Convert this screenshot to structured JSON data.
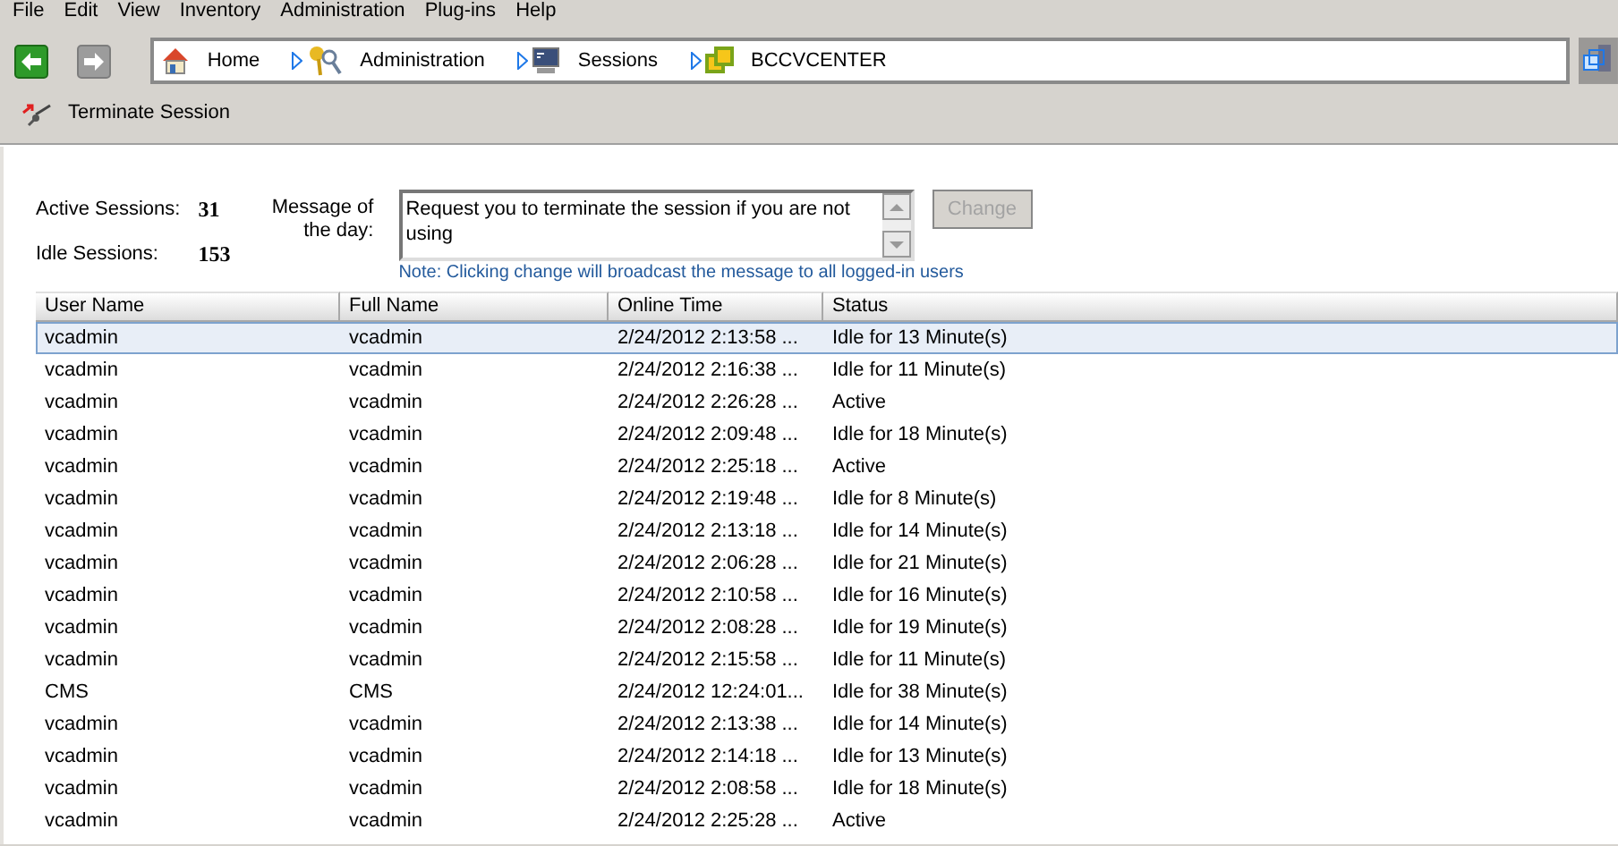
{
  "menu_bar": [
    "File",
    "Edit",
    "View",
    "Inventory",
    "Administration",
    "Plug-ins",
    "Help"
  ],
  "breadcrumb": [
    {
      "label": "Home",
      "kind": "home"
    },
    {
      "label": "Administration",
      "kind": "admin"
    },
    {
      "label": "Sessions",
      "kind": "sessions"
    },
    {
      "label": "BCCVCENTER",
      "kind": "vcenter"
    }
  ],
  "toolbar": {
    "terminate_button": "Terminate Session"
  },
  "summary": {
    "active_label": "Active Sessions:",
    "active_value": "31",
    "idle_label": "Idle Sessions:",
    "idle_value": "153"
  },
  "message": {
    "label_line_1": "Message of",
    "label_line_2": "the day:",
    "value": "Request you to terminate the session if you are not using",
    "change_button": "Change",
    "change_disabled": true,
    "note": "Note: Clicking change will broadcast the message to all logged-in users"
  },
  "table": {
    "columns": [
      "User Name",
      "Full Name",
      "Online Time",
      "Status"
    ],
    "rows": [
      {
        "cells": [
          "vcadmin",
          "vcadmin",
          "2/24/2012 2:13:58 ...",
          "Idle for 13 Minute(s)"
        ],
        "selected": true
      },
      {
        "cells": [
          "vcadmin",
          "vcadmin",
          "2/24/2012 2:16:38 ...",
          "Idle for 11 Minute(s)"
        ],
        "selected": false
      },
      {
        "cells": [
          "vcadmin",
          "vcadmin",
          "2/24/2012 2:26:28 ...",
          "Active"
        ],
        "selected": false
      },
      {
        "cells": [
          "vcadmin",
          "vcadmin",
          "2/24/2012 2:09:48 ...",
          "Idle for 18 Minute(s)"
        ],
        "selected": false
      },
      {
        "cells": [
          "vcadmin",
          "vcadmin",
          "2/24/2012 2:25:18 ...",
          "Active"
        ],
        "selected": false
      },
      {
        "cells": [
          "vcadmin",
          "vcadmin",
          "2/24/2012 2:19:48 ...",
          "Idle for 8 Minute(s)"
        ],
        "selected": false
      },
      {
        "cells": [
          "vcadmin",
          "vcadmin",
          "2/24/2012 2:13:18 ...",
          "Idle for 14 Minute(s)"
        ],
        "selected": false
      },
      {
        "cells": [
          "vcadmin",
          "vcadmin",
          "2/24/2012 2:06:28 ...",
          "Idle for 21 Minute(s)"
        ],
        "selected": false
      },
      {
        "cells": [
          "vcadmin",
          "vcadmin",
          "2/24/2012 2:10:58 ...",
          "Idle for 16 Minute(s)"
        ],
        "selected": false
      },
      {
        "cells": [
          "vcadmin",
          "vcadmin",
          "2/24/2012 2:08:28 ...",
          "Idle for 19 Minute(s)"
        ],
        "selected": false
      },
      {
        "cells": [
          "vcadmin",
          "vcadmin",
          "2/24/2012 2:15:58 ...",
          "Idle for 11 Minute(s)"
        ],
        "selected": false
      },
      {
        "cells": [
          "CMS",
          "CMS",
          "2/24/2012 12:24:01...",
          "Idle for 38 Minute(s)"
        ],
        "selected": false
      },
      {
        "cells": [
          "vcadmin",
          "vcadmin",
          "2/24/2012 2:13:38 ...",
          "Idle for 14 Minute(s)"
        ],
        "selected": false
      },
      {
        "cells": [
          "vcadmin",
          "vcadmin",
          "2/24/2012 2:14:18 ...",
          "Idle for 13 Minute(s)"
        ],
        "selected": false
      },
      {
        "cells": [
          "vcadmin",
          "vcadmin",
          "2/24/2012 2:08:58 ...",
          "Idle for 18 Minute(s)"
        ],
        "selected": false
      },
      {
        "cells": [
          "vcadmin",
          "vcadmin",
          "2/24/2012 2:25:28 ...",
          "Active"
        ],
        "selected": false
      }
    ]
  }
}
